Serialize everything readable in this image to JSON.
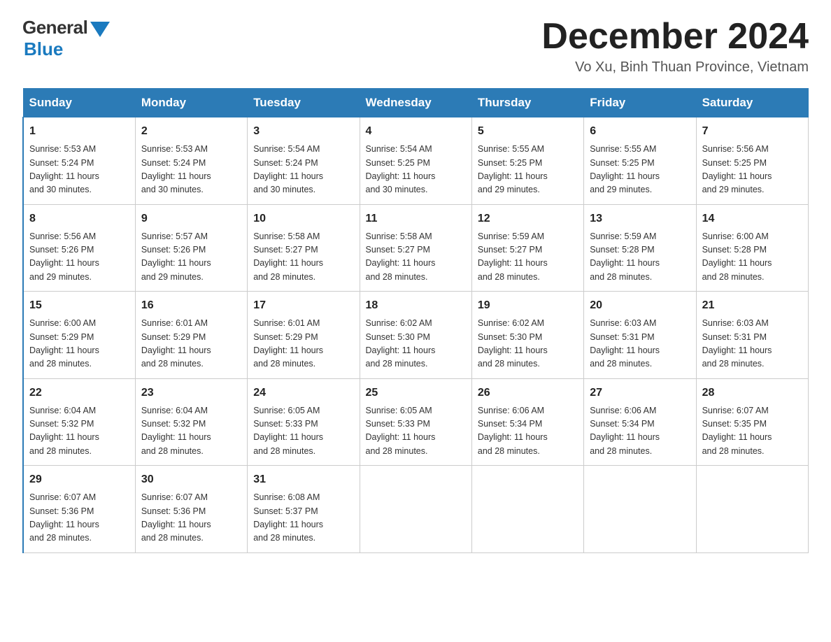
{
  "header": {
    "logo_general": "General",
    "logo_blue": "Blue",
    "title": "December 2024",
    "location": "Vo Xu, Binh Thuan Province, Vietnam"
  },
  "days_of_week": [
    "Sunday",
    "Monday",
    "Tuesday",
    "Wednesday",
    "Thursday",
    "Friday",
    "Saturday"
  ],
  "weeks": [
    [
      {
        "day": "1",
        "sunrise": "5:53 AM",
        "sunset": "5:24 PM",
        "daylight": "11 hours and 30 minutes."
      },
      {
        "day": "2",
        "sunrise": "5:53 AM",
        "sunset": "5:24 PM",
        "daylight": "11 hours and 30 minutes."
      },
      {
        "day": "3",
        "sunrise": "5:54 AM",
        "sunset": "5:24 PM",
        "daylight": "11 hours and 30 minutes."
      },
      {
        "day": "4",
        "sunrise": "5:54 AM",
        "sunset": "5:25 PM",
        "daylight": "11 hours and 30 minutes."
      },
      {
        "day": "5",
        "sunrise": "5:55 AM",
        "sunset": "5:25 PM",
        "daylight": "11 hours and 29 minutes."
      },
      {
        "day": "6",
        "sunrise": "5:55 AM",
        "sunset": "5:25 PM",
        "daylight": "11 hours and 29 minutes."
      },
      {
        "day": "7",
        "sunrise": "5:56 AM",
        "sunset": "5:25 PM",
        "daylight": "11 hours and 29 minutes."
      }
    ],
    [
      {
        "day": "8",
        "sunrise": "5:56 AM",
        "sunset": "5:26 PM",
        "daylight": "11 hours and 29 minutes."
      },
      {
        "day": "9",
        "sunrise": "5:57 AM",
        "sunset": "5:26 PM",
        "daylight": "11 hours and 29 minutes."
      },
      {
        "day": "10",
        "sunrise": "5:58 AM",
        "sunset": "5:27 PM",
        "daylight": "11 hours and 28 minutes."
      },
      {
        "day": "11",
        "sunrise": "5:58 AM",
        "sunset": "5:27 PM",
        "daylight": "11 hours and 28 minutes."
      },
      {
        "day": "12",
        "sunrise": "5:59 AM",
        "sunset": "5:27 PM",
        "daylight": "11 hours and 28 minutes."
      },
      {
        "day": "13",
        "sunrise": "5:59 AM",
        "sunset": "5:28 PM",
        "daylight": "11 hours and 28 minutes."
      },
      {
        "day": "14",
        "sunrise": "6:00 AM",
        "sunset": "5:28 PM",
        "daylight": "11 hours and 28 minutes."
      }
    ],
    [
      {
        "day": "15",
        "sunrise": "6:00 AM",
        "sunset": "5:29 PM",
        "daylight": "11 hours and 28 minutes."
      },
      {
        "day": "16",
        "sunrise": "6:01 AM",
        "sunset": "5:29 PM",
        "daylight": "11 hours and 28 minutes."
      },
      {
        "day": "17",
        "sunrise": "6:01 AM",
        "sunset": "5:29 PM",
        "daylight": "11 hours and 28 minutes."
      },
      {
        "day": "18",
        "sunrise": "6:02 AM",
        "sunset": "5:30 PM",
        "daylight": "11 hours and 28 minutes."
      },
      {
        "day": "19",
        "sunrise": "6:02 AM",
        "sunset": "5:30 PM",
        "daylight": "11 hours and 28 minutes."
      },
      {
        "day": "20",
        "sunrise": "6:03 AM",
        "sunset": "5:31 PM",
        "daylight": "11 hours and 28 minutes."
      },
      {
        "day": "21",
        "sunrise": "6:03 AM",
        "sunset": "5:31 PM",
        "daylight": "11 hours and 28 minutes."
      }
    ],
    [
      {
        "day": "22",
        "sunrise": "6:04 AM",
        "sunset": "5:32 PM",
        "daylight": "11 hours and 28 minutes."
      },
      {
        "day": "23",
        "sunrise": "6:04 AM",
        "sunset": "5:32 PM",
        "daylight": "11 hours and 28 minutes."
      },
      {
        "day": "24",
        "sunrise": "6:05 AM",
        "sunset": "5:33 PM",
        "daylight": "11 hours and 28 minutes."
      },
      {
        "day": "25",
        "sunrise": "6:05 AM",
        "sunset": "5:33 PM",
        "daylight": "11 hours and 28 minutes."
      },
      {
        "day": "26",
        "sunrise": "6:06 AM",
        "sunset": "5:34 PM",
        "daylight": "11 hours and 28 minutes."
      },
      {
        "day": "27",
        "sunrise": "6:06 AM",
        "sunset": "5:34 PM",
        "daylight": "11 hours and 28 minutes."
      },
      {
        "day": "28",
        "sunrise": "6:07 AM",
        "sunset": "5:35 PM",
        "daylight": "11 hours and 28 minutes."
      }
    ],
    [
      {
        "day": "29",
        "sunrise": "6:07 AM",
        "sunset": "5:36 PM",
        "daylight": "11 hours and 28 minutes."
      },
      {
        "day": "30",
        "sunrise": "6:07 AM",
        "sunset": "5:36 PM",
        "daylight": "11 hours and 28 minutes."
      },
      {
        "day": "31",
        "sunrise": "6:08 AM",
        "sunset": "5:37 PM",
        "daylight": "11 hours and 28 minutes."
      },
      null,
      null,
      null,
      null
    ]
  ],
  "labels": {
    "sunrise": "Sunrise:",
    "sunset": "Sunset:",
    "daylight": "Daylight:"
  }
}
